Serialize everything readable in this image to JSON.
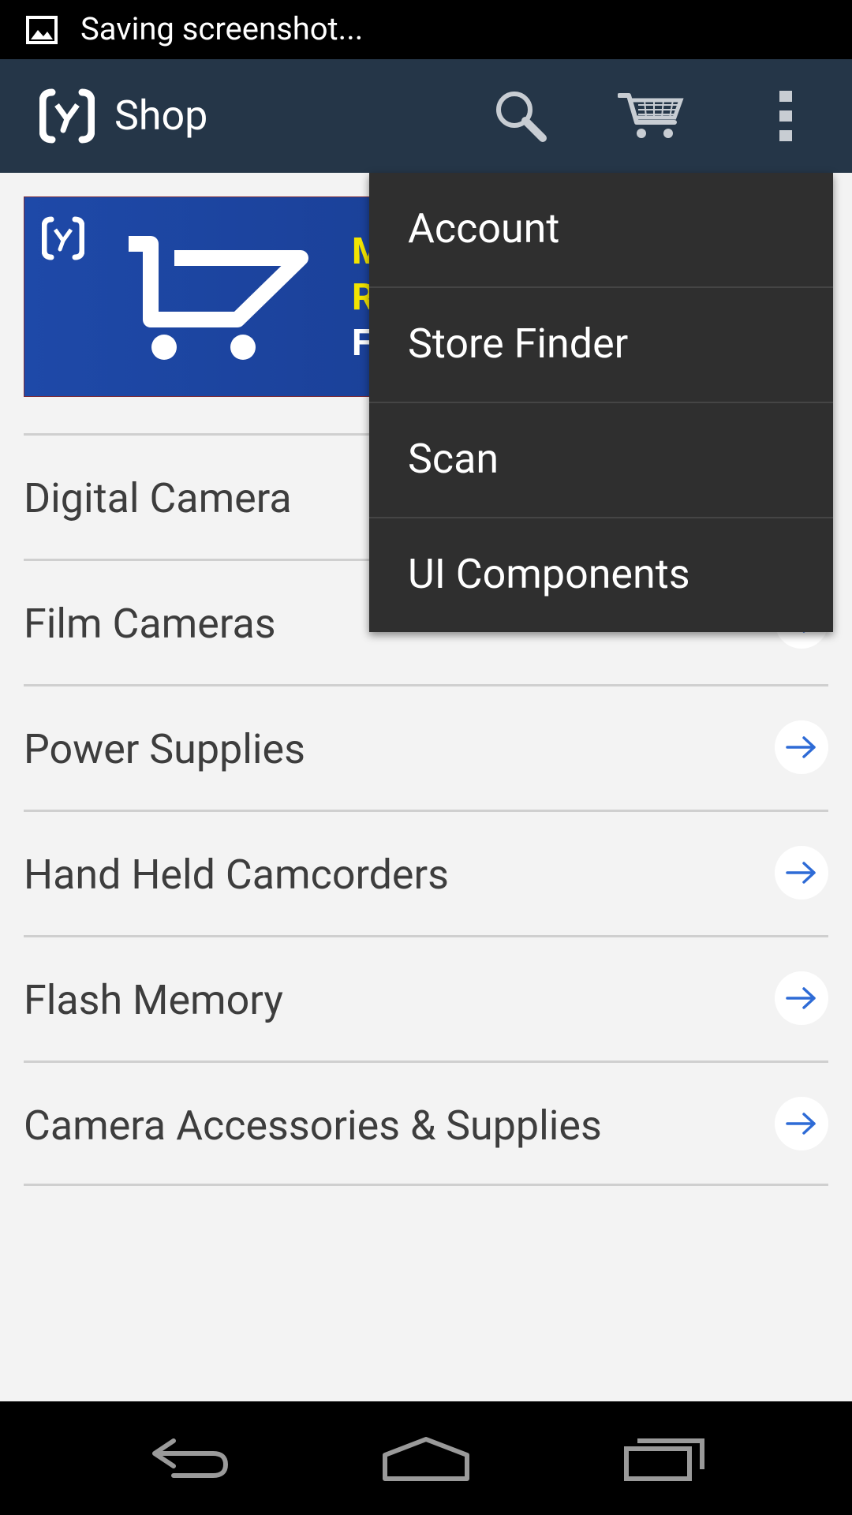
{
  "status_bar": {
    "notification_text": "Saving screenshot..."
  },
  "action_bar": {
    "title": "Shop"
  },
  "banner": {
    "letters": [
      "M",
      "R",
      "F"
    ]
  },
  "categories": [
    {
      "label": "Digital Camera"
    },
    {
      "label": "Film Cameras"
    },
    {
      "label": "Power Supplies"
    },
    {
      "label": "Hand Held Camcorders"
    },
    {
      "label": "Flash Memory"
    },
    {
      "label": "Camera Accessories & Supplies"
    }
  ],
  "overflow_menu": {
    "items": [
      {
        "label": "Account"
      },
      {
        "label": "Store Finder"
      },
      {
        "label": "Scan"
      },
      {
        "label": "UI Components"
      }
    ]
  },
  "icons": {
    "status": "image-icon",
    "app_logo": "app-logo-icon",
    "search": "search-icon",
    "cart": "cart-icon",
    "overflow": "overflow-menu-icon",
    "arrow": "arrow-right-icon",
    "back": "back-icon",
    "home": "home-icon",
    "recents": "recents-icon"
  },
  "colors": {
    "action_bar": "#253648",
    "menu_background": "#2f2f2f",
    "arrow_accent": "#2e6bd6",
    "banner_accent": "#f2e400"
  }
}
